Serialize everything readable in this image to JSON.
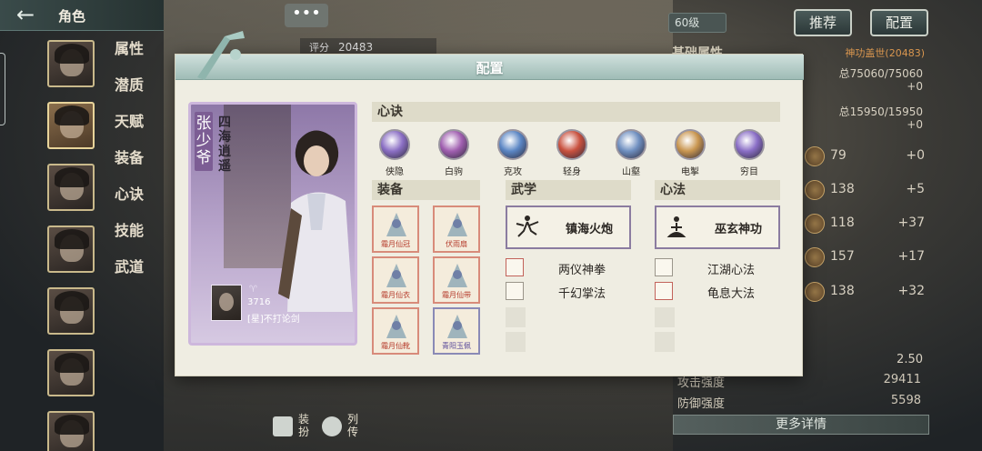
{
  "header": {
    "title": "角色",
    "back_icon": "back-arrow-icon"
  },
  "sidebar": {
    "menu": [
      "属性",
      "潜质",
      "天赋",
      "装备",
      "心诀",
      "技能",
      "武道"
    ],
    "avatars": [
      "角色1",
      "角色2",
      "角色3",
      "角色4",
      "角色5",
      "角色6",
      "角色7",
      "角色8"
    ]
  },
  "top": {
    "chat": "•••",
    "score_label": "评分",
    "score_value": "20483",
    "level": "60级",
    "recommend": "推荐",
    "config": "配置"
  },
  "right_panel": {
    "title": "基础属性",
    "reference": "神功盖世(20483)",
    "hp": "总75060/75060",
    "hp_delta": "+0",
    "mp": "总15950/15950",
    "mp_delta": "+0",
    "rows": [
      {
        "num": "79",
        "delta": "+0"
      },
      {
        "num": "138",
        "delta": "+5"
      },
      {
        "num": "118",
        "delta": "+37"
      },
      {
        "num": "157",
        "delta": "+17"
      },
      {
        "num": "138",
        "delta": "+32"
      }
    ],
    "stat_extra_value": "2.50",
    "stats": [
      {
        "label": "攻击强度",
        "value": "29411"
      },
      {
        "label": "防御强度",
        "value": "5598"
      }
    ],
    "more": "更多详情"
  },
  "bottom": {
    "dress": "装扮",
    "biography": "列传"
  },
  "modal": {
    "title": "配置",
    "character": {
      "name": "张少爷",
      "epithet": "四海逍遥",
      "owner_power": "3716",
      "owner_name": "[星]不打论剑"
    },
    "xinjue_title": "心诀",
    "xinjue": [
      {
        "label": "侠隐",
        "color": "#8b6fc4"
      },
      {
        "label": "白驹",
        "color": "#a05fb0"
      },
      {
        "label": "克攻",
        "color": "#5b86c4"
      },
      {
        "label": "轻身",
        "color": "#c9513f"
      },
      {
        "label": "山壑",
        "color": "#6f8fc0"
      },
      {
        "label": "电掣",
        "color": "#c99650"
      },
      {
        "label": "穷目",
        "color": "#8a6ec6"
      }
    ],
    "equip_title": "装备",
    "equipment": [
      {
        "name": "霜月仙冠",
        "style": "red"
      },
      {
        "name": "伏雨扇",
        "style": "red"
      },
      {
        "name": "霜月仙衣",
        "style": "red"
      },
      {
        "name": "霜月仙带",
        "style": "red"
      },
      {
        "name": "霜月仙靴",
        "style": "red"
      },
      {
        "name": "青阳玉佩",
        "style": "blue"
      }
    ],
    "wuxue_title": "武学",
    "wuxue_main": "镇海火炮",
    "wuxue": [
      "两仪神拳",
      "千幻掌法"
    ],
    "xinfa_title": "心法",
    "xinfa_main": "巫玄神功",
    "xinfa": [
      "江湖心法",
      "龟息大法"
    ]
  }
}
